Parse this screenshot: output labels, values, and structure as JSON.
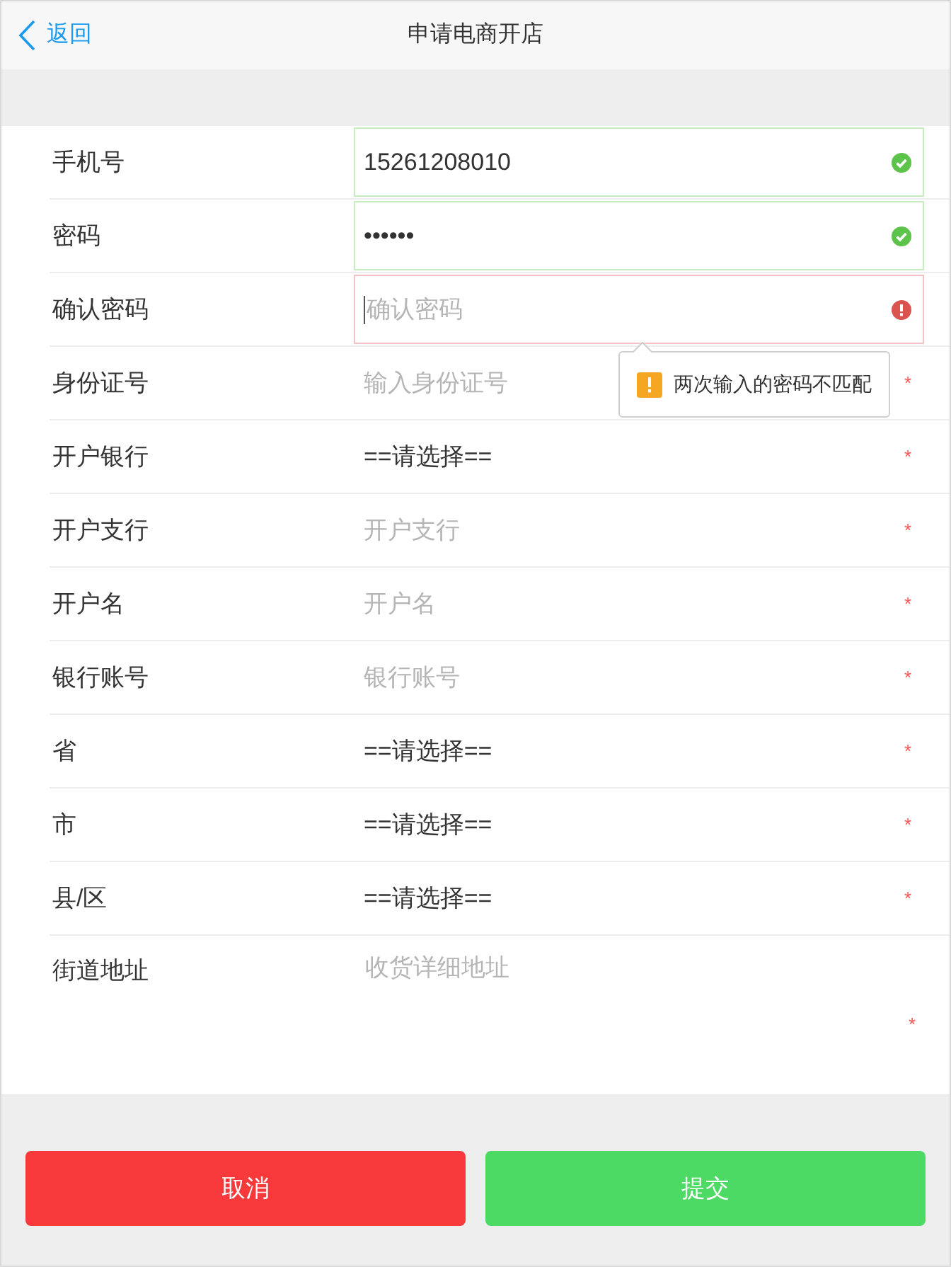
{
  "header": {
    "back": "返回",
    "title": "申请电商开店"
  },
  "fields": [
    {
      "kind": "input",
      "label": "手机号",
      "value": "15261208010",
      "valid": true
    },
    {
      "kind": "input",
      "label": "密码",
      "value": "••••••",
      "valid": true
    },
    {
      "kind": "input",
      "label": "确认密码",
      "placeholder": "确认密码",
      "invalid": true,
      "focused": true
    },
    {
      "kind": "input",
      "label": "身份证号",
      "placeholder": "输入身份证号",
      "mark": "*"
    },
    {
      "kind": "select",
      "label": "开户银行",
      "value": "==请选择==",
      "mark": "*"
    },
    {
      "kind": "input",
      "label": "开户支行",
      "placeholder": "开户支行",
      "mark": "*"
    },
    {
      "kind": "input",
      "label": "开户名",
      "placeholder": "开户名",
      "mark": "*"
    },
    {
      "kind": "input",
      "label": "银行账号",
      "placeholder": "银行账号",
      "mark": "*"
    },
    {
      "kind": "select",
      "label": "省",
      "value": "==请选择==",
      "mark": "*"
    },
    {
      "kind": "select",
      "label": "市",
      "value": "==请选择==",
      "mark": "*"
    },
    {
      "kind": "select",
      "label": "县/区",
      "value": "==请选择==",
      "mark": "*"
    },
    {
      "kind": "textarea",
      "label": "街道地址",
      "placeholder": "收货详细地址",
      "mark": "*"
    }
  ],
  "tooltip": {
    "text": "两次输入的密码不匹配"
  },
  "buttons": [
    {
      "kind": "cancel",
      "label": "取消"
    },
    {
      "kind": "submit",
      "label": "提交"
    }
  ]
}
